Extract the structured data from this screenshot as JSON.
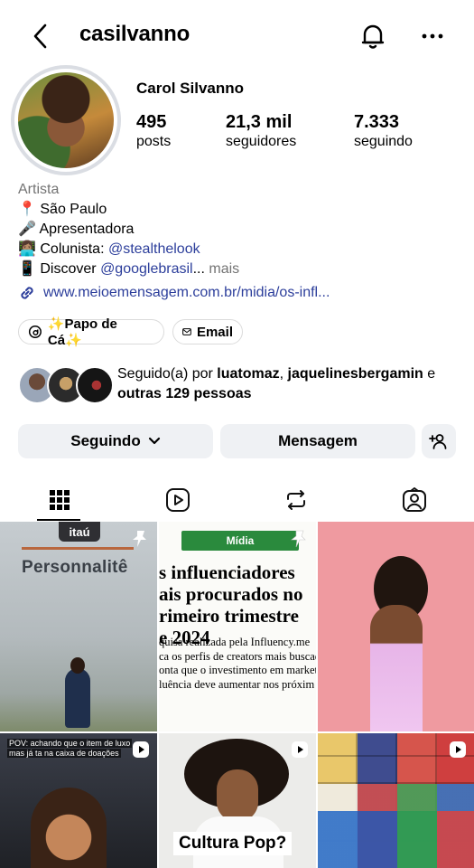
{
  "header": {
    "username": "casilvanno"
  },
  "profile": {
    "display_name": "Carol Silvanno",
    "stats": [
      {
        "value": "495",
        "label": "posts"
      },
      {
        "value": "21,3 mil",
        "label": "seguidores"
      },
      {
        "value": "7.333",
        "label": "seguindo"
      }
    ],
    "category": "Artista",
    "bio": {
      "line1_emoji": "📍",
      "line1": "São Paulo",
      "line2_emoji": "🎤",
      "line2": "Apresentadora",
      "line3_emoji": "👩🏽‍💻",
      "line3_prefix": "Colunista: ",
      "line3_mention": "@stealthelook",
      "line4_emoji": "📱",
      "line4_prefix": "Discover ",
      "line4_mention": "@googlebrasil",
      "line4_ellipsis": "...",
      "more": " mais"
    },
    "link": "www.meioemensagem.com.br/midia/os-infl..."
  },
  "chips": {
    "threads_label": "✨Papo de Cá✨",
    "email_label": "Email"
  },
  "followed_by": {
    "prefix": "Seguido(a) por ",
    "user1": "luatomaz",
    "sep": ", ",
    "user2": "jaquelinesbergamin",
    "mid": " e ",
    "others": "outras 129 pessoas"
  },
  "actions": {
    "following_label": "Seguindo",
    "message_label": "Mensagem"
  },
  "grid": {
    "tile1_sign": "Personnalitê",
    "tile1_brand": "itaú",
    "tile2_tag": "Mídia",
    "tile2_headline": [
      "s influenciadores",
      "ais procurados no",
      "rimeiro trimestre",
      "e 2024"
    ],
    "tile2_body": [
      "quisa realizada pela Influency.me",
      "ca os perfis de creators mais buscad",
      "onta que o investimento em market",
      "luência deve aumentar nos próxim"
    ],
    "tile4_caption": [
      "POV: achando que o item de luxo",
      "mas já ta na caixa de doações"
    ],
    "tile5_label": "Cultura Pop?"
  },
  "colors": {
    "link": "#2c3e9b",
    "button_bg": "#eff1f4",
    "muted": "#737373",
    "green_tag": "#2a8a3d"
  }
}
